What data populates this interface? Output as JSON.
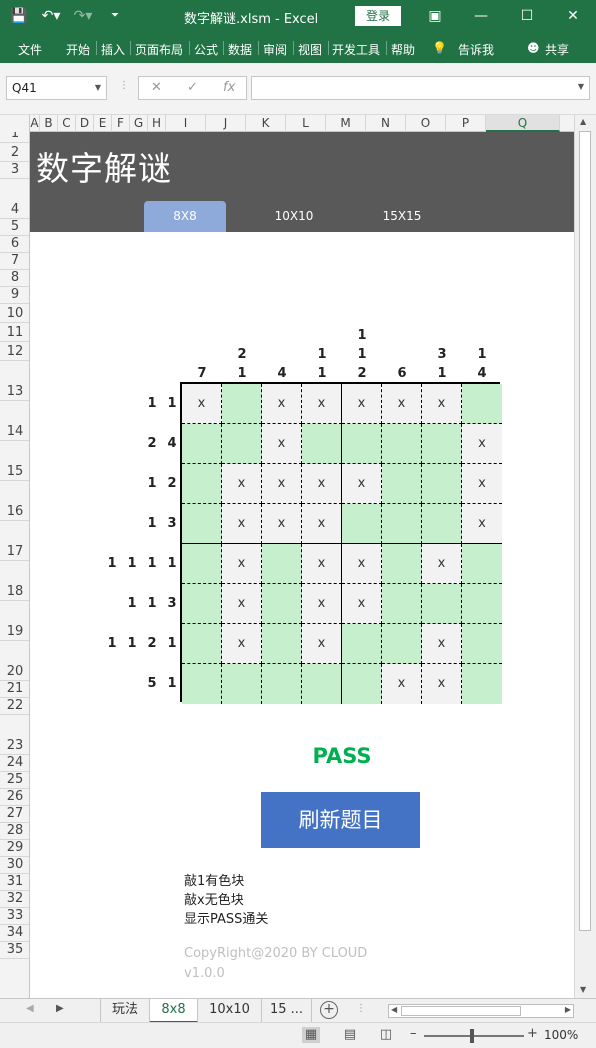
{
  "titlebar": {
    "doc_title": "数字解谜.xlsm  -  Excel",
    "login_label": "登录",
    "qat_icons": [
      "save-icon",
      "undo-icon",
      "redo-icon",
      "customize-qat-icon"
    ]
  },
  "ribbon": {
    "tabs": [
      "文件",
      "开始",
      "插入",
      "页面布局",
      "公式",
      "数据",
      "审阅",
      "视图",
      "开发工具",
      "帮助"
    ],
    "tell_me": "告诉我",
    "share": "共享"
  },
  "formula_bar": {
    "name_box": "Q41",
    "formula_value": ""
  },
  "columns": [
    "A",
    "B",
    "C",
    "D",
    "E",
    "F",
    "G",
    "H",
    "I",
    "J",
    "K",
    "L",
    "M",
    "N",
    "O",
    "P",
    "Q"
  ],
  "selected_column": "Q",
  "rows": [
    "1",
    "2",
    "3",
    "4",
    "5",
    "6",
    "7",
    "8",
    "9",
    "10",
    "11",
    "12",
    "13",
    "14",
    "15",
    "16",
    "17",
    "18",
    "19",
    "20",
    "21",
    "22",
    "23",
    "24",
    "25",
    "26",
    "27",
    "28",
    "29",
    "30",
    "31",
    "32",
    "33",
    "34",
    "35"
  ],
  "game": {
    "title": "数字解谜",
    "modes": [
      "8X8",
      "10X10",
      "15X15"
    ],
    "active_mode": "8X8",
    "column_clues": [
      [
        "7"
      ],
      [
        "2",
        "1"
      ],
      [
        "4"
      ],
      [
        "1",
        "1"
      ],
      [
        "1",
        "1",
        "2"
      ],
      [
        "6"
      ],
      [
        "3",
        "1"
      ],
      [
        "1",
        "4"
      ]
    ],
    "row_clues": [
      [
        "1",
        "1"
      ],
      [
        "2",
        "4"
      ],
      [
        "1",
        "2"
      ],
      [
        "1",
        "3"
      ],
      [
        "1",
        "1",
        "1",
        "1"
      ],
      [
        "1",
        "1",
        "3"
      ],
      [
        "1",
        "1",
        "2",
        "1"
      ],
      [
        "5",
        "1"
      ]
    ],
    "grid": [
      [
        "x",
        "",
        "x",
        "x",
        "x",
        "x",
        "x",
        ""
      ],
      [
        "",
        "",
        "x",
        "",
        "",
        "",
        "",
        "x"
      ],
      [
        "",
        "x",
        "x",
        "x",
        "x",
        "",
        "",
        "x"
      ],
      [
        "",
        "x",
        "x",
        "x",
        "",
        "",
        "",
        "x"
      ],
      [
        "",
        "x",
        "",
        "x",
        "x",
        "",
        "x",
        ""
      ],
      [
        "",
        "x",
        "",
        "x",
        "x",
        "",
        "",
        ""
      ],
      [
        "",
        "x",
        "",
        "x",
        "",
        "",
        "x",
        ""
      ],
      [
        "",
        "",
        "",
        "",
        "",
        "x",
        "x",
        ""
      ]
    ],
    "status": "PASS",
    "refresh_label": "刷新题目",
    "help": [
      "敲1有色块",
      "敲x无色块",
      "显示PASS通关"
    ],
    "copyright": "CopyRight@2020 BY CLOUD",
    "version": "v1.0.0"
  },
  "sheet_tabs": [
    "玩法",
    "8x8",
    "10x10",
    "15 ..."
  ],
  "active_sheet": "8x8",
  "status_bar": {
    "zoom": "100%"
  },
  "colors": {
    "excel_green": "#217346",
    "banner_gray": "#595959",
    "active_mode_tab": "#8eaadb",
    "filled_cell": "#c6efce",
    "empty_cell": "#f2f2f2",
    "pass_green": "#00b050",
    "button_blue": "#4472c4"
  }
}
